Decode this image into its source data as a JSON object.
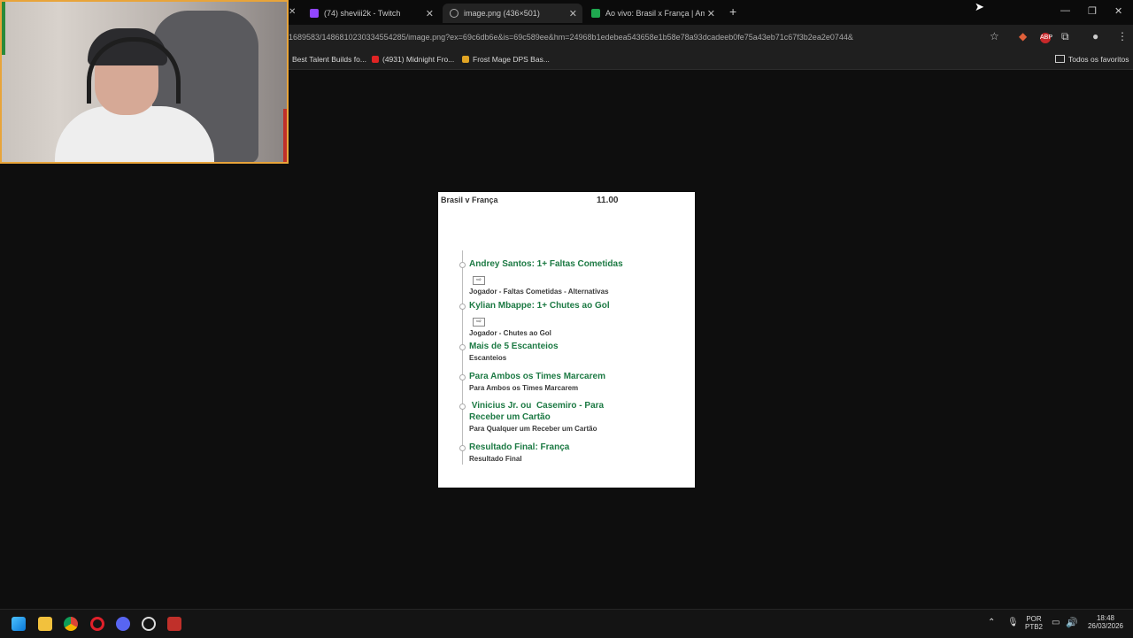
{
  "browser": {
    "tabs": [
      {
        "title": "(74) sheviii2k - Twitch",
        "active": false
      },
      {
        "title": "image.png (436×501)",
        "active": true
      },
      {
        "title": "Ao vivo: Brasil x França | Amisto",
        "active": false
      }
    ],
    "new_tab": "+",
    "window_controls": {
      "minimize": "—",
      "maximize": "❐",
      "close": "✕"
    },
    "url": "1689583/1486810230334554285/image.png?ex=69c6db6e&is=69c589ee&hm=24968b1edebea543658e1b58e78a93dcadeeb0fe75a43eb71c67f3b2ea2e0744&",
    "bookmarks": [
      {
        "label": "Best Talent Builds fo...",
        "color": "#2a6bd6"
      },
      {
        "label": "(4931) Midnight Fro...",
        "color": "#e02424"
      },
      {
        "label": "Frost Mage DPS Bas...",
        "color": "#e0a424"
      }
    ],
    "favorites_label": "Todos os favoritos"
  },
  "bet_slip": {
    "match": "Brasil v França",
    "odds": "11.00",
    "selections": [
      {
        "name": "Andrey Santos: 1+ Faltas Cometidas",
        "market": "Jogador - Faltas Cometidas - Alternativas",
        "icon": true
      },
      {
        "name": "Kylian Mbappe: 1+ Chutes ao Gol",
        "market": "Jogador - Chutes ao Gol",
        "icon": true
      },
      {
        "name": "Mais de 5 Escanteios",
        "market": "Escanteios",
        "icon": false
      },
      {
        "name": "Para Ambos os Times Marcarem",
        "market": "Para Ambos os Times Marcarem",
        "icon": false
      },
      {
        "name": " Vinicius Jr. ou  Casemiro - Para Receber um Cartão",
        "market": "Para Qualquer um Receber um Cartão",
        "icon": false
      },
      {
        "name": "Resultado Final: França",
        "market": "Resultado Final",
        "icon": false
      }
    ]
  },
  "taskbar": {
    "language": "POR",
    "layout": "PTB2",
    "time": "18:48",
    "date": "26/03/2026"
  },
  "colors": {
    "accent_green": "#1d7a44",
    "cam_border": "#e8a43a"
  }
}
